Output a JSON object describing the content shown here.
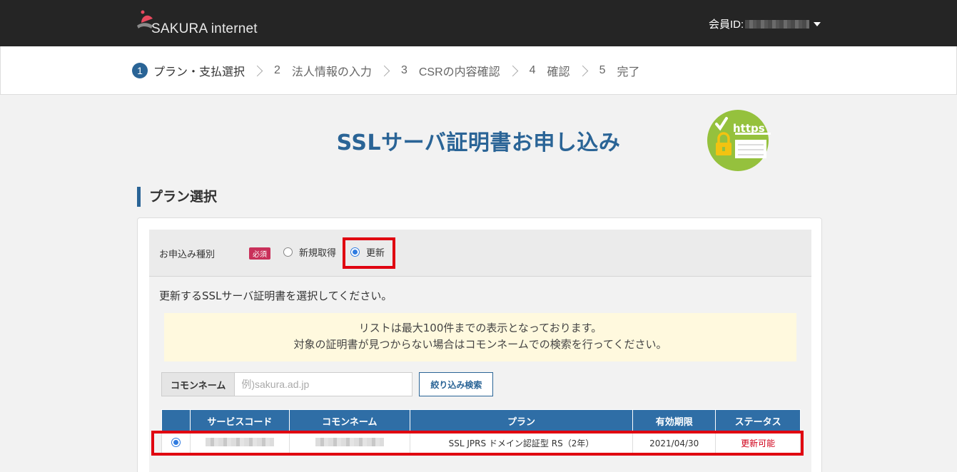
{
  "header": {
    "brand": "SAKURA internet",
    "member_label": "会員ID:"
  },
  "steps": [
    {
      "num": "1",
      "label": "プラン・支払選択",
      "active": true
    },
    {
      "num": "2",
      "label": "法人情報の入力"
    },
    {
      "num": "3",
      "label": "CSRの内容確認"
    },
    {
      "num": "4",
      "label": "確認"
    },
    {
      "num": "5",
      "label": "完了"
    }
  ],
  "page": {
    "title": "SSLサーバ証明書お申し込み",
    "badge_text": "https"
  },
  "section": {
    "heading": "プラン選択"
  },
  "form": {
    "label": "お申込み種別",
    "required": "必須",
    "option_new": "新規取得",
    "option_renew": "更新",
    "selected": "更新"
  },
  "renew": {
    "instruction": "更新するSSLサーバ証明書を選択してください。",
    "notice_line1": "リストは最大100件までの表示となっております。",
    "notice_line2": "対象の証明書が見つからない場合はコモンネームでの検索を行ってください。",
    "search_label": "コモンネーム",
    "search_placeholder": "例)sakura.ad.jp",
    "search_value": "",
    "search_button": "絞り込み検索"
  },
  "table": {
    "headers": [
      "",
      "サービスコード",
      "コモンネーム",
      "プラン",
      "有効期限",
      "ステータス"
    ],
    "rows": [
      {
        "selected": true,
        "service_code": "",
        "common_name": "",
        "plan": "SSL JPRS ドメイン認証型 RS（2年）",
        "expiry": "2021/04/30",
        "status": "更新可能"
      }
    ]
  },
  "colors": {
    "header_bg": "#252525",
    "accent": "#2a6496",
    "required_badge": "#c9305a",
    "highlight": "#e00010",
    "status_text": "#d0021b",
    "notice_bg": "#fff9de"
  }
}
